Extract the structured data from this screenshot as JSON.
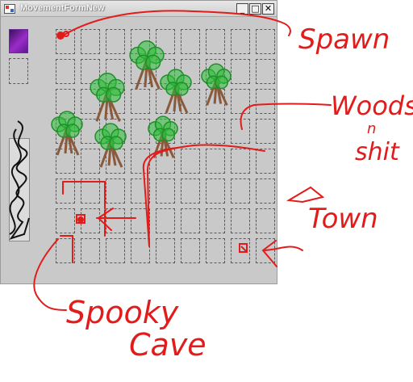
{
  "window": {
    "title": "MovementFormNew"
  },
  "controls": {
    "minimize": "_",
    "maximize": "□",
    "close": "✕"
  },
  "grid": {
    "rows": 8,
    "columns": 9
  },
  "annotations": {
    "spawn": "Spawn",
    "woods_line1": "Woods",
    "woods_line2": "n",
    "woods_line3": "shit",
    "town": "Town",
    "cave_line1": "Spooky",
    "cave_line2": "Cave"
  },
  "colors": {
    "annotation": "#e21b1b",
    "tree_canopy": "#2fbf3a",
    "tree_trunk": "#8a5a3c"
  }
}
